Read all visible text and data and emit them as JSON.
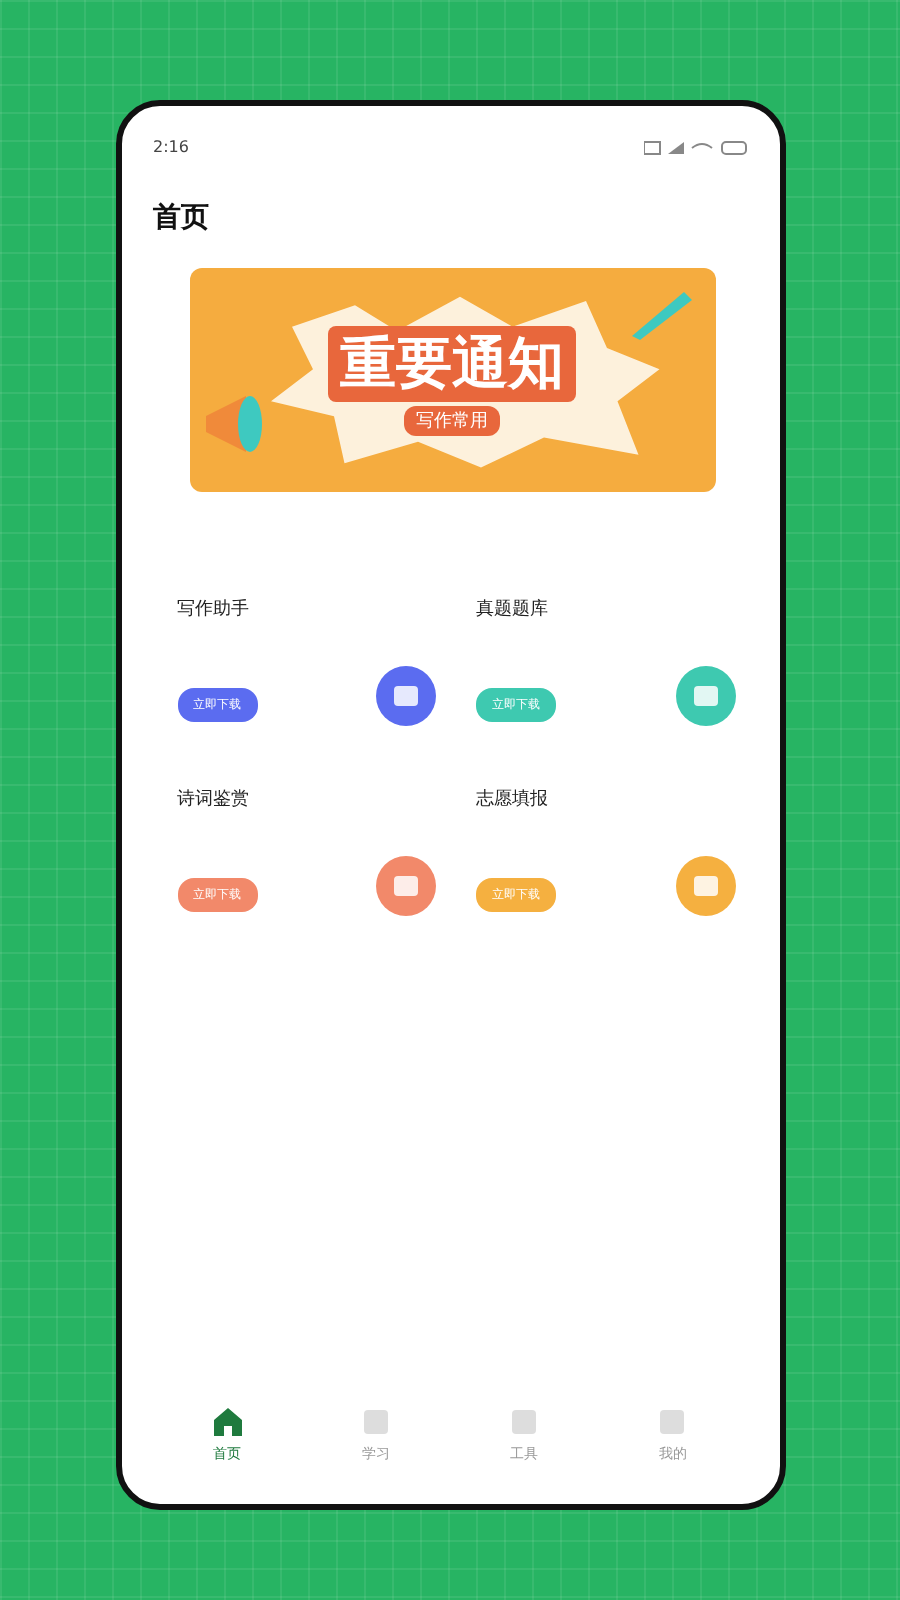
{
  "status_bar": {
    "time": "2:16"
  },
  "page_title": "首页",
  "banner": {
    "title": "重要通知",
    "subtitle": "写作常用"
  },
  "features": [
    {
      "title": "写作助手",
      "button": "立即下载",
      "color": "#5b6cf0"
    },
    {
      "title": "真题题库",
      "button": "立即下载",
      "color": "#3ec9b0"
    },
    {
      "title": "诗词鉴赏",
      "button": "立即下载",
      "color": "#f2896a"
    },
    {
      "title": "志愿填报",
      "button": "立即下载",
      "color": "#f5b040"
    }
  ],
  "tabs": [
    {
      "label": "首页",
      "selected": true
    },
    {
      "label": "学习",
      "selected": false
    },
    {
      "label": "工具",
      "selected": false
    },
    {
      "label": "我的",
      "selected": false
    }
  ]
}
